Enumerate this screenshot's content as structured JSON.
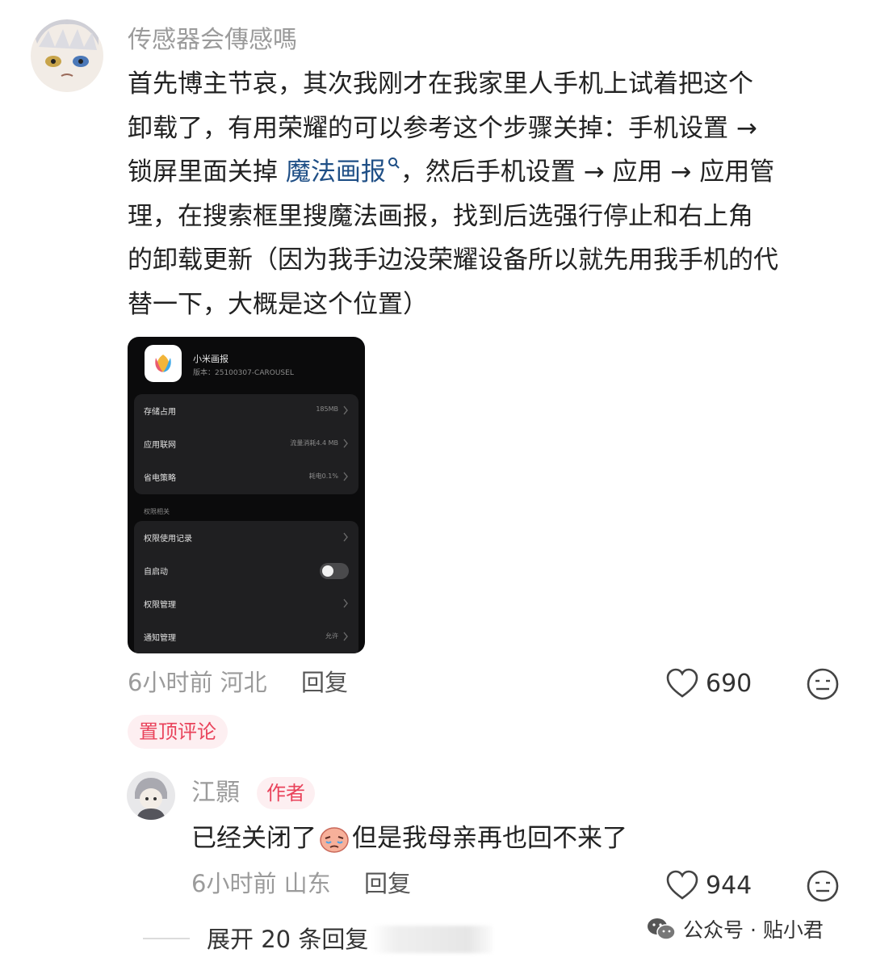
{
  "comment": {
    "username": "传感器会傳感嗎",
    "lines": [
      "首先博主节哀，其次我刚才在我家里人手机上试着把这个",
      "卸载了，有用荣耀的可以参考这个步骤关掉：手机设置 →",
      "锁屏里面关掉",
      "理，在搜索框里搜魔法画报，找到后选强行停止和右上角",
      "的卸载更新（因为我手边没荣耀设备所以就先用我手机的代",
      "替一下，大概是这个位置）"
    ],
    "link_text": "魔法画报",
    "line3_after": "，然后手机设置 → 应用 → 应用管",
    "time": "6小时前",
    "location": "河北",
    "reply_label": "回复",
    "likes": "690",
    "pinned_label": "置顶评论"
  },
  "embedded_screenshot": {
    "app_name": "小米画报",
    "version": "版本：25100307-CAROUSEL",
    "rows_top": [
      {
        "label": "存储占用",
        "value": "185MB"
      },
      {
        "label": "应用联网",
        "value": "流量消耗4.4 MB"
      },
      {
        "label": "省电策略",
        "value": "耗电0.1%"
      }
    ],
    "section_label": "权限相关",
    "rows_bottom": [
      {
        "label": "权限使用记录",
        "value": ""
      },
      {
        "label": "自启动",
        "value": "",
        "toggle": false
      },
      {
        "label": "权限管理",
        "value": ""
      },
      {
        "label": "通知管理",
        "value": "允许"
      }
    ]
  },
  "reply": {
    "username": "江顥",
    "badge": "作者",
    "text_before": "已经关闭了",
    "emoji": "crying-face-emoji",
    "text_after": "但是我母亲再也回不来了",
    "time": "6小时前",
    "location": "山东",
    "reply_label": "回复",
    "likes": "944"
  },
  "expand_label": "展开 20 条回复",
  "watermark": "公众号 · 贴小君",
  "colors": {
    "accent_red": "#e9435b",
    "badge_bg": "#fdeff1",
    "link_blue": "#1f4f86",
    "meta_gray": "#9b9b9b"
  }
}
